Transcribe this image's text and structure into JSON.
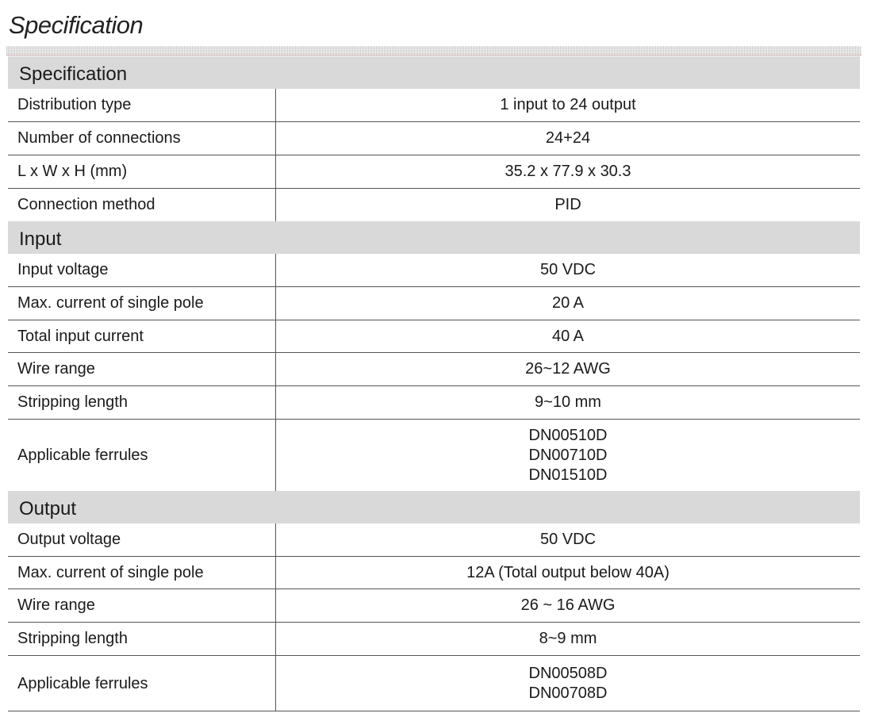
{
  "page_title": "Specification",
  "sections": [
    {
      "title": "Specification",
      "rows": [
        {
          "label": "Distribution type",
          "values": [
            "1 input to 24 output"
          ]
        },
        {
          "label": "Number of connections",
          "values": [
            "24+24"
          ]
        },
        {
          "label": "L x W x H (mm)",
          "values": [
            "35.2 x 77.9 x 30.3"
          ]
        },
        {
          "label": "Connection method",
          "values": [
            "PID"
          ]
        }
      ]
    },
    {
      "title": "Input",
      "rows": [
        {
          "label": "Input voltage",
          "values": [
            "50 VDC"
          ]
        },
        {
          "label": "Max. current of single pole",
          "values": [
            "20 A"
          ]
        },
        {
          "label": "Total input current",
          "values": [
            "40 A"
          ]
        },
        {
          "label": "Wire range",
          "values": [
            "26~12 AWG"
          ]
        },
        {
          "label": "Stripping length",
          "values": [
            "9~10 mm"
          ]
        },
        {
          "label": "Applicable ferrules",
          "values": [
            "DN00510D",
            "DN00710D",
            "DN01510D"
          ]
        }
      ]
    },
    {
      "title": "Output",
      "rows": [
        {
          "label": "Output voltage",
          "values": [
            "50 VDC"
          ]
        },
        {
          "label": "Max. current of single pole",
          "values": [
            "12A (Total output below 40A)"
          ]
        },
        {
          "label": "Wire range",
          "values": [
            "26 ~ 16 AWG"
          ]
        },
        {
          "label": "Stripping length",
          "values": [
            "8~9 mm"
          ]
        },
        {
          "label": "Applicable ferrules",
          "values": [
            "DN00508D",
            "DN00708D"
          ]
        }
      ]
    }
  ]
}
